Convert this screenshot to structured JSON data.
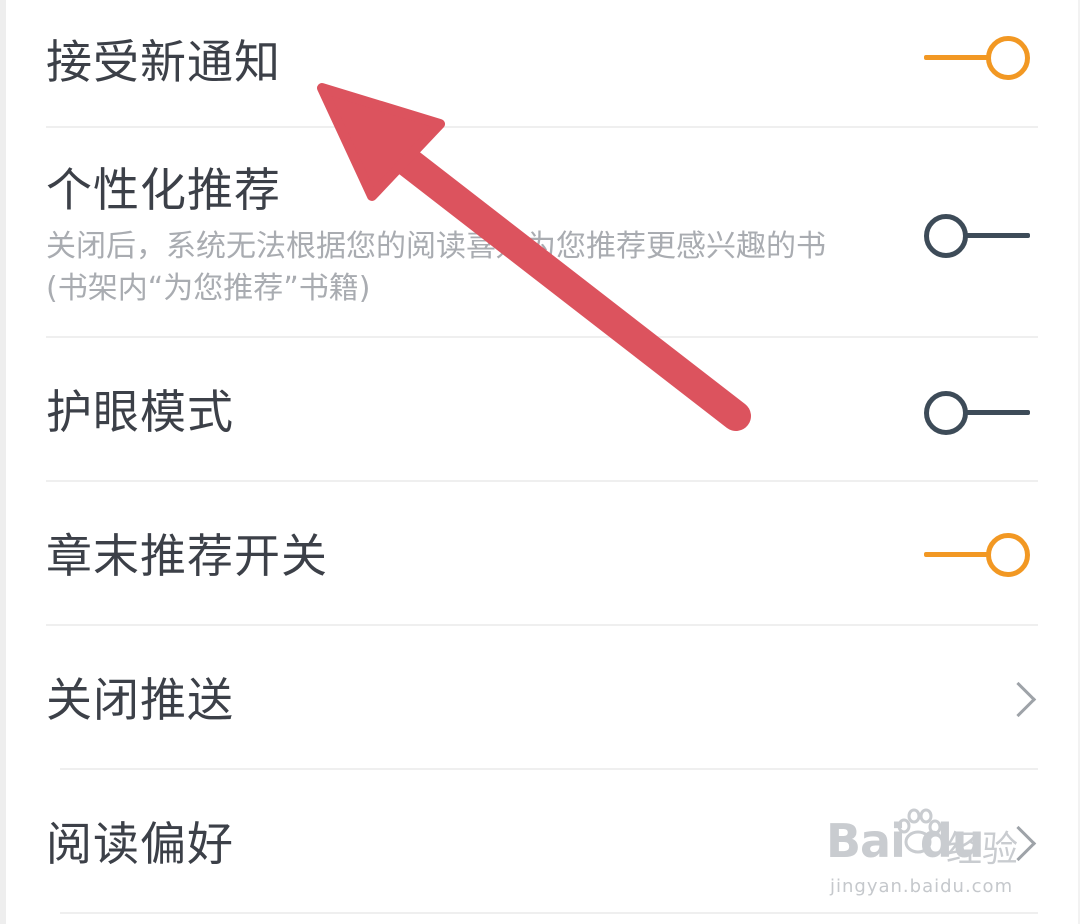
{
  "settings": {
    "receive_notifications": {
      "label": "接受新通知",
      "enabled": true
    },
    "personalized_recommendation": {
      "label": "个性化推荐",
      "description": "关闭后，系统无法根据您的阅读喜好为您推荐更感兴趣的书(书架内“为您推荐”书籍)",
      "enabled": false
    },
    "eye_protection": {
      "label": "护眼模式",
      "enabled": false
    },
    "chapter_end_recommendation": {
      "label": "章末推荐开关",
      "enabled": true
    },
    "close_push": {
      "label": "关闭推送"
    },
    "reading_preferences": {
      "label": "阅读偏好"
    }
  },
  "colors": {
    "toggle_on": "#f29823",
    "toggle_off": "#3d4b58",
    "annotation_arrow": "#dc535e"
  },
  "watermark": {
    "logo": "Bai du",
    "text": "经验",
    "url": "jingyan.baidu.com"
  }
}
